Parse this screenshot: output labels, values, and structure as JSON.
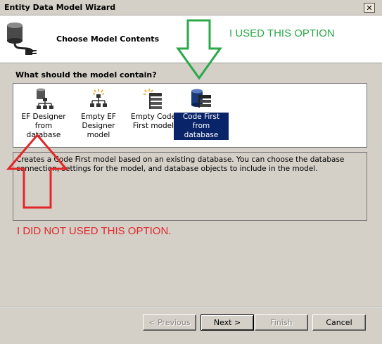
{
  "window": {
    "title": "Entity Data Model Wizard",
    "close_symbol": "✕"
  },
  "header": {
    "title": "Choose Model Contents"
  },
  "section": {
    "label": "What should the model contain?"
  },
  "options": [
    {
      "label": "EF Designer\nfrom database",
      "selected": false
    },
    {
      "label": "Empty EF\nDesigner model",
      "selected": false
    },
    {
      "label": "Empty Code\nFirst model",
      "selected": false
    },
    {
      "label": "Code First\nfrom database",
      "selected": true
    }
  ],
  "description": "Creates a Code First model based on an existing database. You can choose the database connection, settings for the model, and database objects to include in the model.",
  "annotations": {
    "used": "I USED THIS OPTION",
    "not_used": "I DID NOT USED THIS OPTION."
  },
  "buttons": {
    "previous": "< Previous",
    "next": "Next >",
    "finish": "Finish",
    "cancel": "Cancel"
  },
  "colors": {
    "selection": "#0a246a",
    "annotation_green": "#2ba84a",
    "annotation_red": "#e3262a"
  }
}
